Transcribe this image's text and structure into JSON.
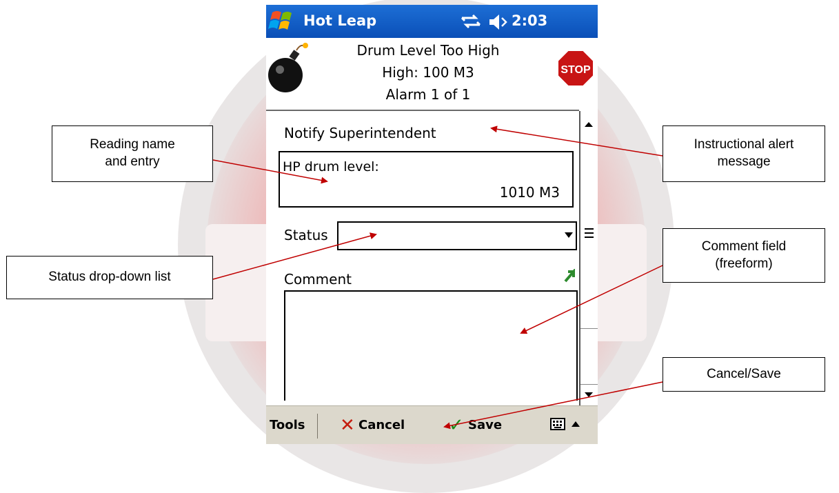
{
  "titlebar": {
    "app_title": "Hot Leap",
    "clock": "2:03"
  },
  "alarm": {
    "line1": "Drum Level Too High",
    "line2": "High: 100 M3",
    "line3": "Alarm 1 of 1",
    "stop_sign_text": "STOP"
  },
  "form": {
    "instruction": "Notify Superintendent",
    "reading_name": "HP drum level:",
    "reading_value": "1010  M3",
    "status_label": "Status",
    "status_value": "",
    "comment_label": "Comment",
    "comment_value": ""
  },
  "menubar": {
    "tools": "Tools",
    "cancel": "Cancel",
    "save": "Save"
  },
  "callouts": {
    "reading": "Reading name and entry",
    "status": "Status drop-down list",
    "instruction": "Instructional alert message",
    "comment": "Comment field (freeform)",
    "cancel_save": "Cancel/Save"
  },
  "colors": {
    "titlebar": "#0a4fb7",
    "menubar": "#dcd8cc",
    "arrow": "#c00000",
    "stop_sign": "#c81414"
  },
  "icons": [
    "windows-start-icon",
    "connectivity-icon",
    "speaker-icon",
    "bomb-icon",
    "stop-sign-icon",
    "send-icon",
    "keyboard-icon"
  ]
}
